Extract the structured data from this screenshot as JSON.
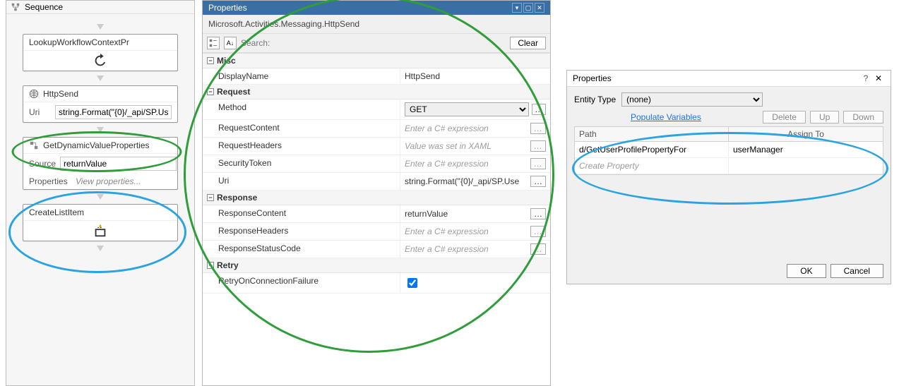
{
  "designer": {
    "title": "Sequence",
    "activities": {
      "lookup": {
        "title": "LookupWorkflowContextPr"
      },
      "http": {
        "title": "HttpSend",
        "uri_label": "Uri",
        "uri_value": "string.Format(\"{0}/_api/SP.Use"
      },
      "getdyn": {
        "title": "GetDynamicValueProperties",
        "source_label": "Source",
        "source_value": "returnValue",
        "props_label": "Properties",
        "props_link": "View properties..."
      },
      "createlist": {
        "title": "CreateListItem"
      }
    }
  },
  "props": {
    "title": "Properties",
    "subtitle": "Microsoft.Activities.Messaging.HttpSend",
    "search_label": "Search:",
    "clear_label": "Clear",
    "cats": {
      "misc": "Misc",
      "request": "Request",
      "response": "Response",
      "retry": "Retry"
    },
    "rows": {
      "displayname": {
        "name": "DisplayName",
        "value": "HttpSend"
      },
      "method": {
        "name": "Method",
        "value": "GET"
      },
      "requestcontent": {
        "name": "RequestContent",
        "placeholder": "Enter a C# expression"
      },
      "requestheaders": {
        "name": "RequestHeaders",
        "value": "Value was set in XAML"
      },
      "securitytoken": {
        "name": "SecurityToken",
        "placeholder": "Enter a C# expression"
      },
      "uri": {
        "name": "Uri",
        "value": "string.Format(\"{0}/_api/SP.Use"
      },
      "responsecontent": {
        "name": "ResponseContent",
        "value": "returnValue"
      },
      "responseheaders": {
        "name": "ResponseHeaders",
        "placeholder": "Enter a C# expression"
      },
      "responsestatus": {
        "name": "ResponseStatusCode",
        "placeholder": "Enter a C# expression"
      },
      "retryconn": {
        "name": "RetryOnConnectionFailure"
      }
    }
  },
  "dlg": {
    "title": "Properties",
    "entity_label": "Entity Type",
    "entity_value": "(none)",
    "populate": "Populate Variables",
    "delete": "Delete",
    "up": "Up",
    "down": "Down",
    "col_path": "Path",
    "col_assign": "Assign To",
    "rows": [
      {
        "path": "d/GetUserProfilePropertyFor",
        "assign": "userManager"
      }
    ],
    "ghost": "Create Property",
    "ok": "OK",
    "cancel": "Cancel"
  }
}
